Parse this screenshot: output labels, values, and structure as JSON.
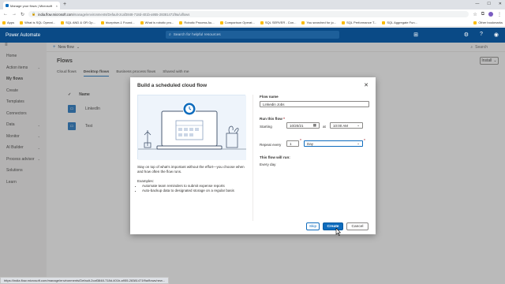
{
  "browser": {
    "tab_title": "Manage your flows | Microsoft",
    "tab_close": "×",
    "new_tab": "+",
    "url_domain": "india.flow.microsoft.com",
    "url_path": "/manage/environments/Default-2caf3848-718d-401b-a955-28381471f9a/uiflows",
    "bookmarks": [
      "Apps",
      "What is SQL Operat...",
      "SQL AND & OR Op...",
      "blueprism-1 Found...",
      "What is robotic pro...",
      "Robotic Process Au...",
      "Comparison Operat...",
      "SQL SERVER - Con...",
      "You searched for jo...",
      "SQL Performance T...",
      "SQL Aggregate Fun..."
    ],
    "other_bookmarks": "Other bookmarks"
  },
  "app": {
    "name": "Power Automate",
    "search_placeholder": "Search for helpful resources",
    "env_icon": "environment-icon"
  },
  "sidebar": {
    "items": [
      {
        "label": "Home",
        "chev": ""
      },
      {
        "label": "Action items",
        "chev": "⌄"
      },
      {
        "label": "My flows",
        "chev": ""
      },
      {
        "label": "Create",
        "chev": ""
      },
      {
        "label": "Templates",
        "chev": ""
      },
      {
        "label": "Connectors",
        "chev": ""
      },
      {
        "label": "Data",
        "chev": "⌄"
      },
      {
        "label": "Monitor",
        "chev": "⌄"
      },
      {
        "label": "AI Builder",
        "chev": "⌄"
      },
      {
        "label": "Process advisor",
        "chev": "⌄"
      },
      {
        "label": "Solutions",
        "chev": ""
      },
      {
        "label": "Learn",
        "chev": ""
      }
    ]
  },
  "main": {
    "new_flow": "New flow",
    "search": "Search",
    "title": "Flows",
    "install": "Install",
    "tabs": [
      "Cloud flows",
      "Desktop flows",
      "Business process flows",
      "Shared with me"
    ],
    "column_name": "Name",
    "rows": [
      "LinkedIn",
      "Test"
    ]
  },
  "modal": {
    "title": "Build a scheduled cloud flow",
    "description": "Stay on top of what's important without the effort—you choose when and how often the flow runs.",
    "examples_heading": "Examples:",
    "examples": [
      "Automate team reminders to submit expense reports",
      "Auto-backup data to designated storage on a regular basis"
    ],
    "flow_name_label": "Flow name",
    "flow_name_value": "Linkedin Jobs",
    "run_label": "Run this flow",
    "starting_label": "Starting",
    "start_date": "10/20/21",
    "at_label": "at",
    "start_time": "10:00 AM",
    "repeat_label": "Repeat every",
    "repeat_number": "1",
    "repeat_unit": "Day",
    "will_run_label": "This flow will run:",
    "will_run_value": "Every day",
    "skip": "Skip",
    "create": "Create",
    "cancel": "Cancel"
  },
  "status_url": "https://india.flow.microsoft.com/manage/environments/Default-2caf3848-718d-401b-a955-28381471f9a/flows/new..."
}
